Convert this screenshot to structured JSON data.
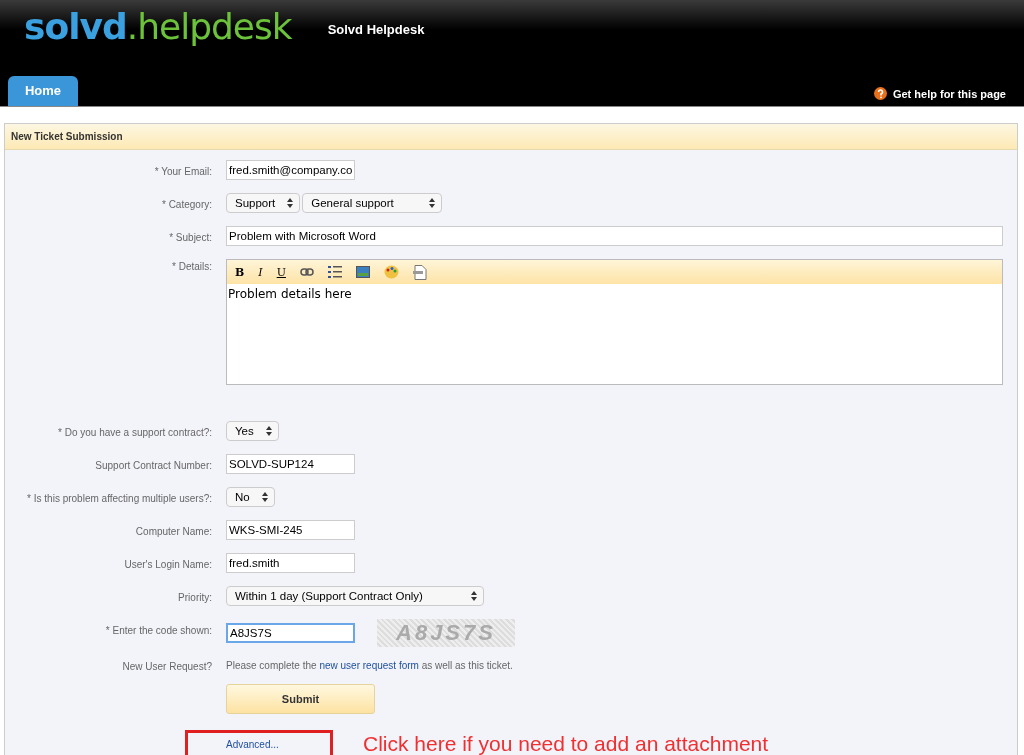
{
  "logo": {
    "part1": "solvd",
    "part2": ".helpdesk"
  },
  "site_title": "Solvd Helpdesk",
  "tabs": [
    {
      "label": "Home",
      "selected": true
    }
  ],
  "help_link": "Get help for this page",
  "panel_title": "New Ticket Submission",
  "fields": [
    {
      "kind": "input",
      "label": "* Your Email:",
      "value": "fred.smith@company.co",
      "focused": false
    },
    {
      "kind": "selects",
      "label": "* Category:",
      "values": [
        "Support",
        "General support"
      ]
    },
    {
      "kind": "wide-input",
      "label": "* Subject:",
      "value": "Problem with Microsoft Word",
      "focused": false
    },
    {
      "kind": "editor",
      "label": "* Details:",
      "format_buttons": [
        "B",
        "I",
        "U"
      ],
      "value": "Problem details here"
    },
    {
      "kind": "selects",
      "label": "* Do you have a support contract?:",
      "values": [
        "Yes"
      ]
    },
    {
      "kind": "input",
      "label": "Support Contract Number:",
      "value": "SOLVD-SUP124",
      "focused": false
    },
    {
      "kind": "selects",
      "label": "* Is this problem affecting multiple users?:",
      "values": [
        "No"
      ]
    },
    {
      "kind": "input",
      "label": "Computer Name:",
      "value": "WKS-SMI-245",
      "focused": false
    },
    {
      "kind": "input",
      "label": "User's Login Name:",
      "value": "fred.smith",
      "focused": false
    },
    {
      "kind": "selects",
      "label": "Priority:",
      "values": [
        "Within 1 day (Support Contract Only)"
      ]
    },
    {
      "kind": "captcha",
      "label": "* Enter the code shown:",
      "value": "A8JS7S",
      "focused": true,
      "code": "A8JS7S"
    },
    {
      "kind": "note",
      "label": "New User Request?",
      "before": "Please complete the",
      "link": "new user request form",
      "after": "as well as this ticket."
    }
  ],
  "submit": "Submit",
  "advanced_link": "Advanced...",
  "annotation": "Click here if you need to add an attachment"
}
